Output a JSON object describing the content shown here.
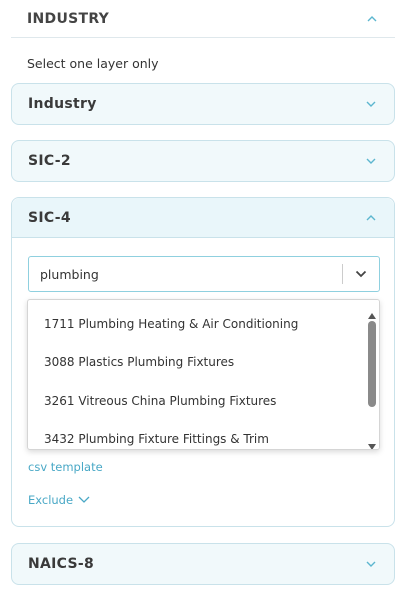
{
  "header": {
    "title": "INDUSTRY",
    "icon": "chevron-up-icon"
  },
  "hint": "Select one layer only",
  "accordions": {
    "industry": {
      "title": "Industry",
      "icon": "chevron-down-icon"
    },
    "sic2": {
      "title": "SIC-2",
      "icon": "chevron-down-icon"
    },
    "sic4": {
      "title": "SIC-4",
      "icon": "chevron-up-icon",
      "search_value": "plumbing",
      "options": [
        "1711 Plumbing Heating & Air Conditioning",
        "3088 Plastics Plumbing Fixtures",
        "3261 Vitreous China Plumbing Fixtures",
        "3432 Plumbing Fixture Fittings & Trim"
      ],
      "csv_link": "csv template",
      "exclude_label": "Exclude"
    },
    "naics8": {
      "title": "NAICS-8",
      "icon": "chevron-down-icon"
    }
  },
  "colors": {
    "accent": "#49a8c6",
    "border": "#c9e2ea",
    "header_bg": "#e9f6fa"
  }
}
